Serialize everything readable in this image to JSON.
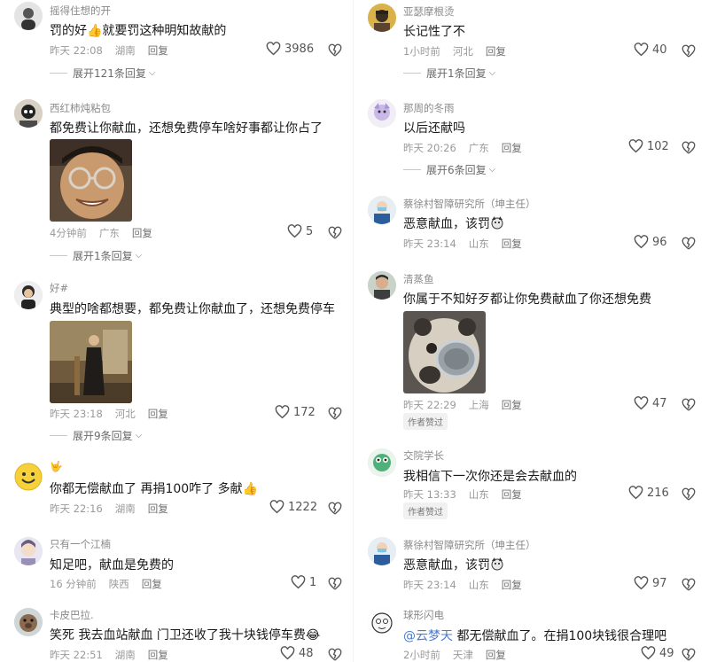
{
  "left": [
    {
      "user": "摇得住想的开",
      "text": "罚的好👍就要罚这种明知故献的",
      "time": "昨天 22:08",
      "loc": "湖南",
      "reply": "回复",
      "likes": "3986",
      "expand": "展开121条回复"
    },
    {
      "user": "西红柿炖粘包",
      "text": "都免费让你献血，还想免费停车啥好事都让你占了",
      "time": "4分钟前",
      "loc": "广东",
      "reply": "回复",
      "likes": "5",
      "expand": "展开1条回复"
    },
    {
      "user": "好#",
      "text": "典型的啥都想要，都免费让你献血了，还想免费停车",
      "time": "昨天 23:18",
      "loc": "河北",
      "reply": "回复",
      "likes": "172",
      "expand": "展开9条回复"
    },
    {
      "user": "🤟",
      "text": "你都无偿献血了 再捐100咋了 多献👍",
      "time": "昨天 22:16",
      "loc": "湖南",
      "reply": "回复",
      "likes": "1222"
    },
    {
      "user": "只有一个江楠",
      "text": "知足吧，献血是免费的",
      "time": "16 分钟前",
      "loc": "陕西",
      "reply": "回复",
      "likes": "1"
    },
    {
      "user": "卡皮巴拉.",
      "text": "笑死 我去血站献血 门卫还收了我十块钱停车费😂",
      "time": "昨天 22:51",
      "loc": "湖南",
      "reply": "回复",
      "likes": "48"
    }
  ],
  "right": [
    {
      "user": "亚瑟摩根烫",
      "text": "长记性了不",
      "time": "1小时前",
      "loc": "河北",
      "reply": "回复",
      "likes": "40",
      "expand": "展开1条回复"
    },
    {
      "user": "那周的冬雨",
      "text": "以后还献吗",
      "time": "昨天 20:26",
      "loc": "广东",
      "reply": "回复",
      "likes": "102",
      "expand": "展开6条回复"
    },
    {
      "user": "蔡徐村智障研究所（坤主任）",
      "text": "恶意献血，该罚",
      "time": "昨天 23:14",
      "loc": "山东",
      "reply": "回复",
      "likes": "96"
    },
    {
      "user": "清蒸鱼",
      "text": "你属于不知好歹都让你免费献血了你还想免费",
      "time": "昨天 22:29",
      "loc": "上海",
      "reply": "回复",
      "likes": "47",
      "badge": "作者赞过"
    },
    {
      "user": "交院学长",
      "text": "我相信下一次你还是会去献血的",
      "time": "昨天 13:33",
      "loc": "山东",
      "reply": "回复",
      "likes": "216",
      "badge": "作者赞过"
    },
    {
      "user": "蔡徐村智障研究所（坤主任）",
      "text": "恶意献血，该罚",
      "time": "昨天 23:14",
      "loc": "山东",
      "reply": "回复",
      "likes": "97"
    },
    {
      "user": "球形闪电",
      "mention": "@云梦天",
      "text": " 都无偿献血了。在捐100块钱很合理吧",
      "time": "2小时前",
      "loc": "天津",
      "reply": "回复",
      "likes": "49"
    }
  ],
  "colors": {
    "text": "#1a1a1a",
    "meta": "#9a9a9a",
    "mention": "#4a7bd3",
    "background": "#ffffff"
  },
  "icons": {
    "like": "heart-outline-icon",
    "dislike": "broken-heart-icon",
    "expand": "chevron-down-icon"
  }
}
